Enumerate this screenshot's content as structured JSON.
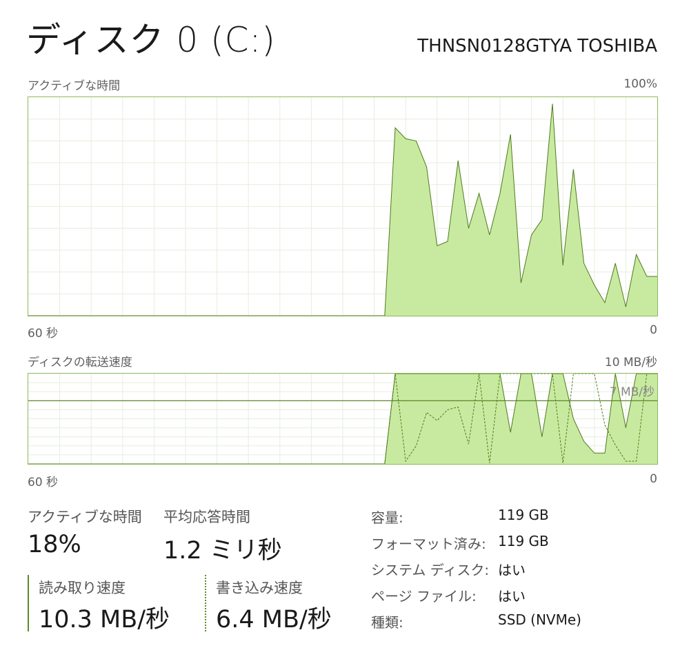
{
  "header": {
    "title": "ディスク 0 (C:)",
    "model": "THNSN0128GTYA TOSHIBA"
  },
  "active_time_graph": {
    "label": "アクティブな時間",
    "max_label": "100%",
    "x_left_label": "60 秒",
    "x_right_label": "0"
  },
  "transfer_graph": {
    "label": "ディスクの転送速度",
    "max_label": "10 MB/秒",
    "ref_line_label": "7 MB/秒",
    "x_left_label": "60 秒",
    "x_right_label": "0"
  },
  "stats": {
    "active_time_label": "アクティブな時間",
    "active_time_value": "18%",
    "response_label": "平均応答時間",
    "response_value": "1.2 ミリ秒",
    "read_label": "読み取り速度",
    "read_value": "10.3 MB/秒",
    "write_label": "書き込み速度",
    "write_value": "6.4 MB/秒"
  },
  "info": [
    {
      "label": "容量:",
      "value": "119 GB"
    },
    {
      "label": "フォーマット済み:",
      "value": "119 GB"
    },
    {
      "label": "システム ディスク:",
      "value": "はい"
    },
    {
      "label": "ページ ファイル:",
      "value": "はい"
    },
    {
      "label": "種類:",
      "value": "SSD (NVMe)"
    }
  ],
  "colors": {
    "accent_line": "#4e7a1a",
    "fill": "#c8eaa0",
    "grid": "#e6eedd",
    "border": "#8cb85a"
  },
  "chart_data": [
    {
      "type": "area",
      "title": "アクティブな時間",
      "xlabel": "",
      "ylabel": "",
      "xlim": [
        60,
        0
      ],
      "ylim": [
        0,
        100
      ],
      "x": [
        60,
        26,
        25,
        24,
        23,
        22,
        21,
        20,
        19,
        18,
        17,
        16,
        15,
        14,
        13,
        12,
        11,
        10,
        9,
        8,
        7,
        6,
        5,
        4,
        3,
        2,
        1,
        0
      ],
      "series": [
        {
          "values": [
            0,
            0,
            86,
            81,
            80,
            68,
            32,
            34,
            71,
            40,
            56,
            37,
            56,
            83,
            15,
            37,
            44,
            97,
            23,
            67,
            24,
            14,
            6,
            24,
            4,
            28,
            18,
            18
          ]
        }
      ],
      "grid": true
    },
    {
      "type": "area",
      "title": "ディスクの転送速度",
      "xlabel": "",
      "ylabel": "",
      "xlim": [
        60,
        0
      ],
      "ylim": [
        0,
        10
      ],
      "reference_line": 7,
      "x": [
        60,
        26,
        25,
        24,
        23,
        22,
        21,
        20,
        19,
        18,
        17,
        16,
        15,
        14,
        13,
        12,
        11,
        10,
        9,
        8,
        7,
        6,
        5,
        4,
        3,
        2,
        1,
        0
      ],
      "series": [
        {
          "name": "読み取り速度",
          "values": [
            0,
            0,
            10,
            10,
            10,
            10,
            10,
            10,
            10,
            10,
            10,
            10,
            10,
            3.5,
            10,
            10,
            3,
            10,
            10,
            5,
            2.5,
            1.2,
            1.2,
            10,
            4,
            10,
            10,
            10
          ]
        },
        {
          "name": "書き込み速度",
          "values": [
            0,
            0,
            10,
            0.3,
            2,
            5.7,
            4.8,
            6,
            6.3,
            2.2,
            10,
            0.1,
            10,
            10,
            10,
            10,
            10,
            10,
            0.1,
            10,
            10,
            10,
            4.3,
            2.1,
            0.3,
            0.3,
            10,
            10
          ]
        }
      ],
      "grid": true
    }
  ]
}
